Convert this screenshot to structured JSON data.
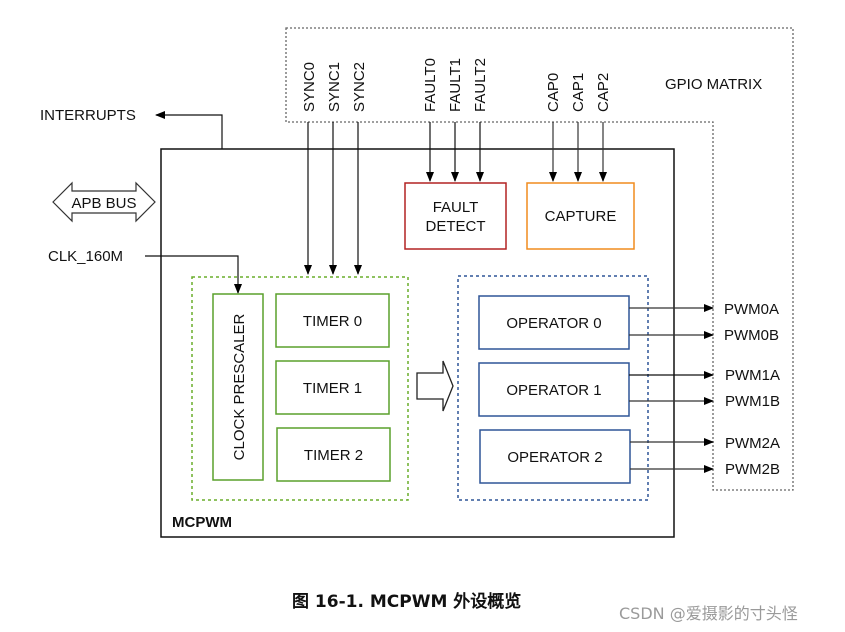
{
  "diagram": {
    "gpio_matrix": {
      "label": "GPIO MATRIX"
    },
    "sync_signals": [
      "SYNC0",
      "SYNC1",
      "SYNC2"
    ],
    "fault_signals": [
      "FAULT0",
      "FAULT1",
      "FAULT2"
    ],
    "cap_signals": [
      "CAP0",
      "CAP1",
      "CAP2"
    ],
    "interrupts": {
      "label": "INTERRUPTS"
    },
    "apb_bus": {
      "label": "APB BUS"
    },
    "clk": {
      "label": "CLK_160M"
    },
    "mcpwm": {
      "label": "MCPWM"
    },
    "fault_detect": {
      "line1": "FAULT",
      "line2": "DETECT",
      "color": "#b22222"
    },
    "capture": {
      "label": "CAPTURE",
      "color": "#f08c1e"
    },
    "clock_prescaler": {
      "label": "CLOCK PRESCALER",
      "color": "#5aa02c"
    },
    "timers": [
      "TIMER 0",
      "TIMER 1",
      "TIMER 2"
    ],
    "operators": [
      "OPERATOR 0",
      "OPERATOR 1",
      "OPERATOR 2"
    ],
    "operator_color": "#2f5597",
    "pwm_outputs": [
      "PWM0A",
      "PWM0B",
      "PWM1A",
      "PWM1B",
      "PWM2A",
      "PWM2B"
    ]
  },
  "caption": "图 16-1. MCPWM 外设概览",
  "watermark": "CSDN @爱摄影的寸头怪"
}
